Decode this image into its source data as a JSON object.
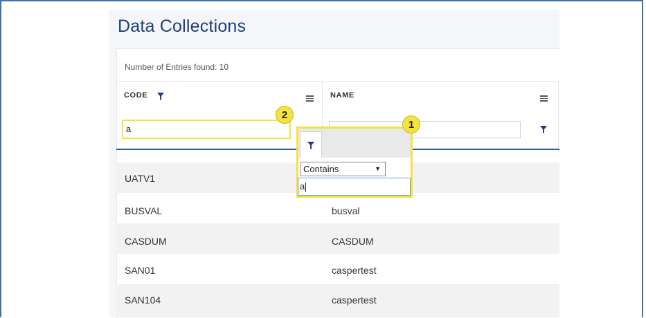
{
  "page": {
    "title": "Data Collections",
    "entries_label": "Number of Entries found:  10"
  },
  "columns": {
    "code": {
      "label": "CODE",
      "filter_value": "a"
    },
    "name": {
      "label": "NAME",
      "filter_value": ""
    }
  },
  "rows": [
    {
      "code": "UATV1",
      "name": ""
    },
    {
      "code": "BUSVAL",
      "name": "busval"
    },
    {
      "code": "CASDUM",
      "name": "CASDUM"
    },
    {
      "code": "SAN01",
      "name": "caspertest"
    },
    {
      "code": "SAN104",
      "name": "caspertest"
    }
  ],
  "filter_popup": {
    "operator": "Contains",
    "value": "a"
  },
  "callouts": {
    "one": "1",
    "two": "2"
  },
  "icons": {
    "filter": "filter-funnel-icon",
    "menu": "hamburger-menu-icon",
    "dropdown": "dropdown-arrow-icon"
  },
  "colors": {
    "accent": "#2a5aa0",
    "title": "#1f3f7a",
    "highlight": "#f3e33e"
  }
}
